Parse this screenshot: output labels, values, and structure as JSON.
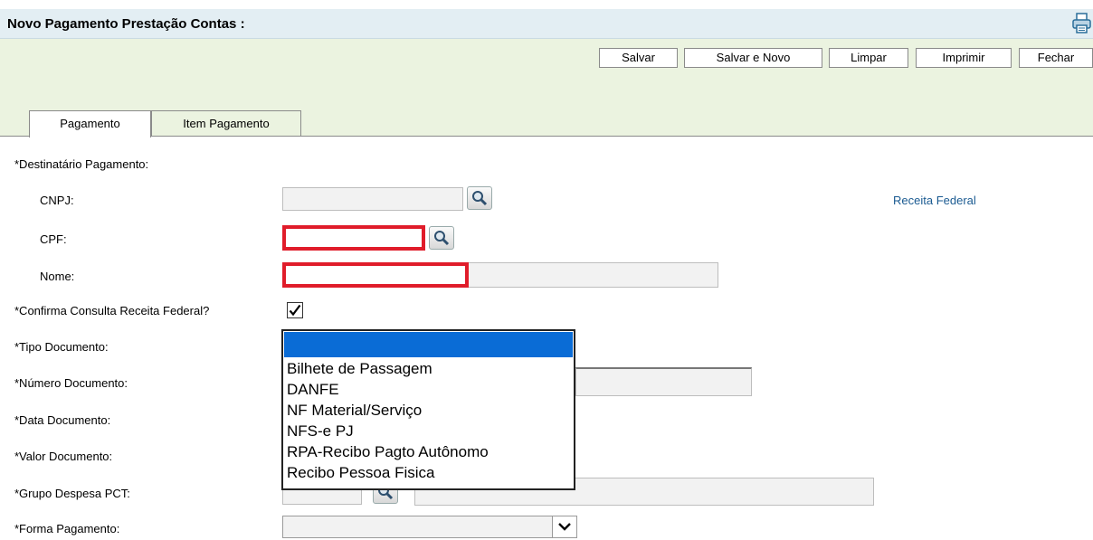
{
  "header": {
    "title": "Novo Pagamento Prestação Contas :"
  },
  "toolbar": {
    "salvar": "Salvar",
    "salvar_novo": "Salvar e Novo",
    "limpar": "Limpar",
    "imprimir": "Imprimir",
    "fechar": "Fechar"
  },
  "tabs": [
    {
      "label": "Pagamento"
    },
    {
      "label": "Item Pagamento"
    }
  ],
  "form": {
    "destinatario": "*Destinatário Pagamento:",
    "cnpj": "CNPJ:",
    "receita_link": "Receita Federal",
    "cpf": "CPF:",
    "nome": "Nome:",
    "confirma": "*Confirma Consulta Receita Federal?",
    "tipo_documento": "*Tipo Documento:",
    "numero_documento": "*Número Documento:",
    "data_documento": "*Data Documento:",
    "valor_documento": "*Valor Documento:",
    "grupo_despesa": "*Grupo Despesa PCT:",
    "forma_pagamento": "*Forma Pagamento:"
  },
  "tipo_options": [
    "Bilhete de Passagem",
    "DANFE",
    "NF Material/Serviço",
    "NFS-e PJ",
    "RPA-Recibo Pagto Autônomo",
    "Recibo Pessoa Fisica"
  ],
  "colors": {
    "accent": "#0a6cd6",
    "error": "#e01c2a",
    "link": "#1a5a91",
    "header_bg": "#e3eef3",
    "toolbar_bg": "#ebf3e0"
  }
}
